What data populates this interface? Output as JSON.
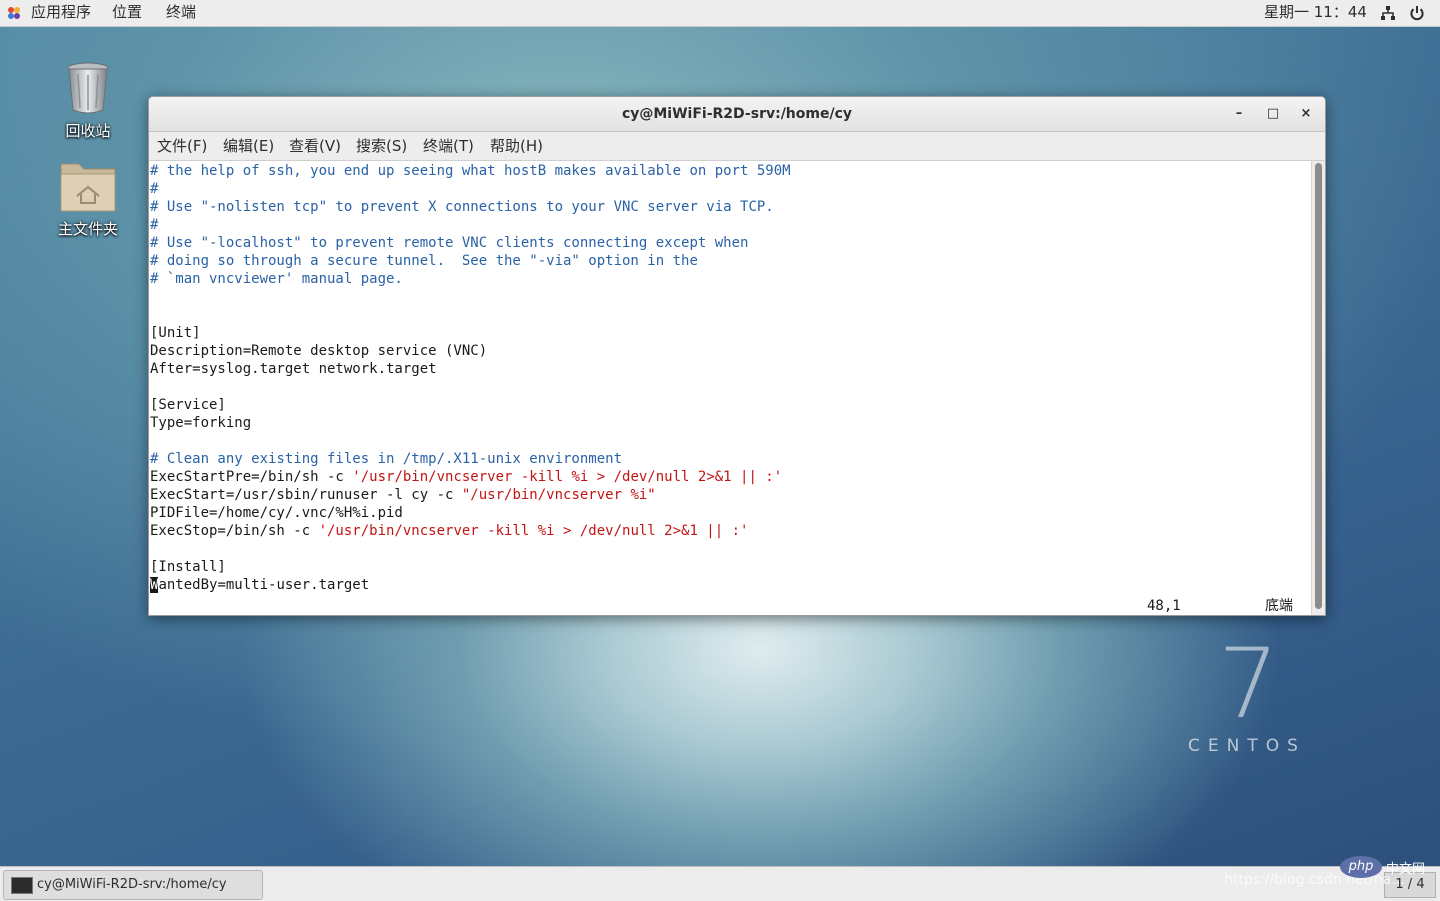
{
  "topbar": {
    "apps_label": "应用程序",
    "places_label": "位置",
    "terminal_label": "终端",
    "clock": "星期一 11：44"
  },
  "desktop": {
    "trash_label": "回收站",
    "home_label": "主文件夹"
  },
  "window": {
    "title": "cy@MiWiFi-R2D-srv:/home/cy",
    "minimize": "–",
    "maximize": "□",
    "close": "×",
    "menu": {
      "file": "文件(F)",
      "edit": "编辑(E)",
      "view": "查看(V)",
      "search": "搜索(S)",
      "terminal": "终端(T)",
      "help": "帮助(H)"
    }
  },
  "terminal": {
    "lines": [
      {
        "text": "# the help of ssh, you end up seeing what hostB makes available on port 590M",
        "kind": "comment"
      },
      {
        "text": "#",
        "kind": "comment"
      },
      {
        "text": "# Use \"-nolisten tcp\" to prevent X connections to your VNC server via TCP.",
        "kind": "comment"
      },
      {
        "text": "#",
        "kind": "comment"
      },
      {
        "text": "# Use \"-localhost\" to prevent remote VNC clients connecting except when",
        "kind": "comment"
      },
      {
        "text": "# doing so through a secure tunnel.  See the \"-via\" option in the",
        "kind": "comment"
      },
      {
        "text": "# `man vncviewer' manual page.",
        "kind": "comment"
      },
      {
        "text": "",
        "kind": "plain"
      },
      {
        "text": "",
        "kind": "plain"
      },
      {
        "text": "[Unit]",
        "kind": "plain"
      },
      {
        "text": "Description=Remote desktop service (VNC)",
        "kind": "plain"
      },
      {
        "text": "After=syslog.target network.target",
        "kind": "plain"
      },
      {
        "text": "",
        "kind": "plain"
      },
      {
        "text": "[Service]",
        "kind": "plain"
      },
      {
        "text": "Type=forking",
        "kind": "plain"
      },
      {
        "text": "",
        "kind": "plain"
      },
      {
        "text": "# Clean any existing files in /tmp/.X11-unix environment",
        "kind": "comment"
      },
      {
        "text": "",
        "kind": "split",
        "plain": "ExecStartPre=/bin/sh -c ",
        "str": "'/usr/bin/vncserver -kill %i > /dev/null 2>&1 || :'"
      },
      {
        "text": "",
        "kind": "split",
        "plain": "ExecStart=/usr/sbin/runuser -l cy -c ",
        "str": "\"/usr/bin/vncserver %i\""
      },
      {
        "text": "PIDFile=/home/cy/.vnc/%H%i.pid",
        "kind": "plain"
      },
      {
        "text": "",
        "kind": "split",
        "plain": "ExecStop=/bin/sh -c ",
        "str": "'/usr/bin/vncserver -kill %i > /dev/null 2>&1 || :'"
      },
      {
        "text": "",
        "kind": "plain"
      },
      {
        "text": "[Install]",
        "kind": "plain"
      },
      {
        "text": "",
        "kind": "cursor",
        "cursor_char": "W",
        "rest": "antedBy=multi-user.target"
      }
    ],
    "position": "48,1",
    "scroll_state": "底端"
  },
  "centos": {
    "version": "7",
    "name": "CENTOS"
  },
  "taskbar": {
    "task_label": "cy@MiWiFi-R2D-srv:/home/cy",
    "pager": "1 / 4",
    "watermark": "https://blog.csdn.net/na...",
    "php_badge": "php",
    "php_cn": "中文网"
  },
  "colors": {
    "comment": "#2a62a6",
    "string": "#c31414",
    "text": "#1a1a1a"
  }
}
